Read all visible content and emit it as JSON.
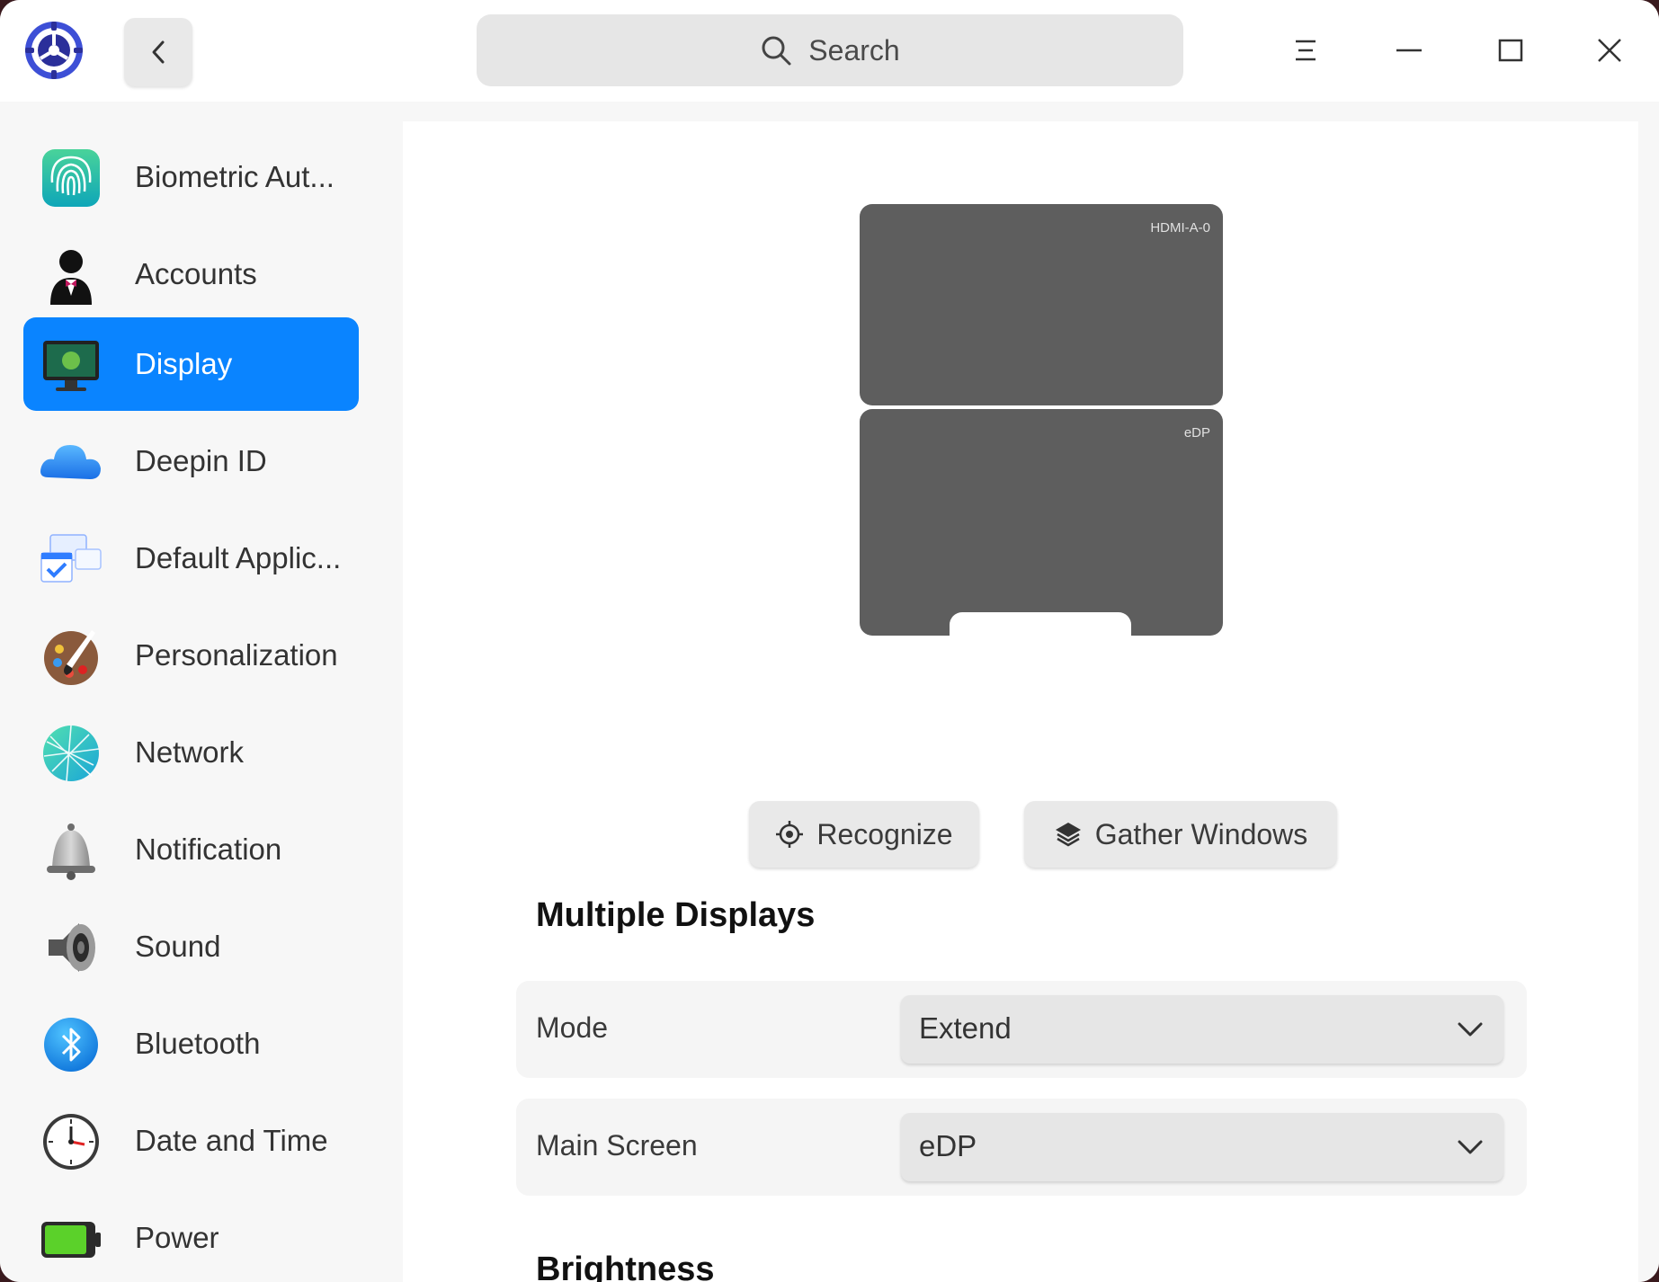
{
  "search": {
    "placeholder": "Search"
  },
  "sidebar": {
    "items": [
      {
        "label": "Biometric Aut...",
        "icon": "fingerprint-icon"
      },
      {
        "label": "Accounts",
        "icon": "user-icon"
      },
      {
        "label": "Display",
        "icon": "monitor-icon",
        "active": true
      },
      {
        "label": "Deepin ID",
        "icon": "cloud-icon"
      },
      {
        "label": "Default Applic...",
        "icon": "default-apps-icon"
      },
      {
        "label": "Personalization",
        "icon": "palette-icon"
      },
      {
        "label": "Network",
        "icon": "network-icon"
      },
      {
        "label": "Notification",
        "icon": "bell-icon"
      },
      {
        "label": "Sound",
        "icon": "speaker-icon"
      },
      {
        "label": "Bluetooth",
        "icon": "bluetooth-icon"
      },
      {
        "label": "Date and Time",
        "icon": "clock-icon"
      },
      {
        "label": "Power",
        "icon": "battery-icon"
      }
    ]
  },
  "displays": {
    "monitors": [
      {
        "name": "HDMI-A-0"
      },
      {
        "name": "eDP"
      }
    ]
  },
  "actions": {
    "recognize": "Recognize",
    "gather_windows": "Gather Windows"
  },
  "multiple_displays": {
    "title": "Multiple Displays",
    "mode_label": "Mode",
    "mode_value": "Extend",
    "main_screen_label": "Main Screen",
    "main_screen_value": "eDP"
  },
  "brightness": {
    "title": "Brightness"
  },
  "colors": {
    "accent": "#0a84ff",
    "monitor_fill": "#5e5e5e"
  }
}
